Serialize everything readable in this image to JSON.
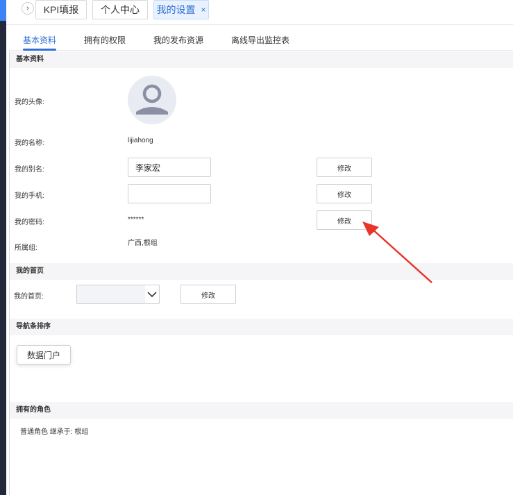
{
  "page_tabs": [
    {
      "label": "KPI填报"
    },
    {
      "label": "个人中心"
    },
    {
      "label": "我的设置",
      "close": "×"
    }
  ],
  "sub_tabs": [
    "基本资料",
    "拥有的权限",
    "我的发布资源",
    "离线导出监控表"
  ],
  "basic": {
    "header": "基本资料",
    "avatar_label": "我的头像:",
    "name_label": "我的名称:",
    "name_value": "lijiahong",
    "alias_label": "我的别名:",
    "alias_value": "李家宏",
    "phone_label": "我的手机:",
    "phone_value": "",
    "password_label": "我的密码:",
    "password_value": "******",
    "group_label": "所属组:",
    "group_value": "广西,根组",
    "modify": "修改"
  },
  "home": {
    "header": "我的首页",
    "label": "我的首页:",
    "modify": "修改"
  },
  "nav_sort": {
    "header": "导航条排序",
    "item": "数据门户"
  },
  "roles": {
    "header": "拥有的角色",
    "text": "普通角色 继承于: 根组"
  },
  "colors": {
    "accent": "#2d6fd6",
    "annotation_arrow": "#e8352a",
    "sidebar": "#23283a"
  }
}
